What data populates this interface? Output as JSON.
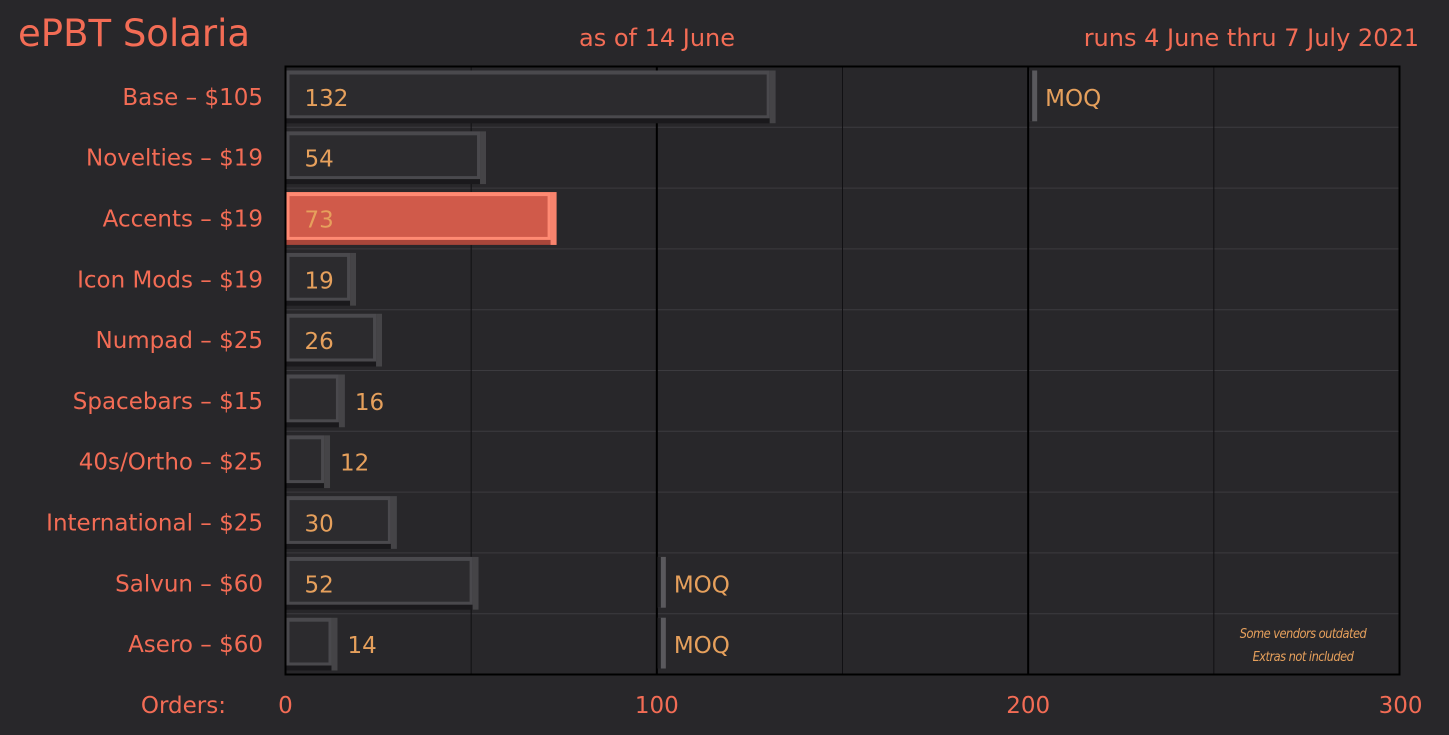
{
  "header": {
    "title": "ePBT Solaria",
    "as_of": "as of 14 June",
    "runs": "runs 4 June thru 7 July 2021"
  },
  "colors": {
    "background": "#28272a",
    "label": "#f36c55",
    "value": "#e6a05c",
    "bar": "#2c2b2e",
    "bar_highlight": "#d05a4a",
    "grid": "#000000"
  },
  "chart_data": {
    "type": "bar",
    "orientation": "horizontal",
    "categories": [
      "Base – $105",
      "Novelties – $19",
      "Accents – $19",
      "Icon Mods – $19",
      "Numpad – $25",
      "Spacebars – $15",
      "40s/Ortho – $25",
      "International – $25",
      "Salvun – $60",
      "Asero – $60"
    ],
    "values": [
      132,
      54,
      73,
      19,
      26,
      16,
      12,
      30,
      52,
      14
    ],
    "highlight_index": 2,
    "moq": [
      200,
      null,
      null,
      null,
      null,
      null,
      null,
      null,
      100,
      100
    ],
    "moq_label": "MOQ",
    "xlabel": "Orders:",
    "xticks": [
      0,
      100,
      200,
      300
    ],
    "xlim": [
      0,
      300
    ],
    "grid_step": 50,
    "notes": [
      "Some vendors outdated",
      "Extras not included"
    ]
  }
}
